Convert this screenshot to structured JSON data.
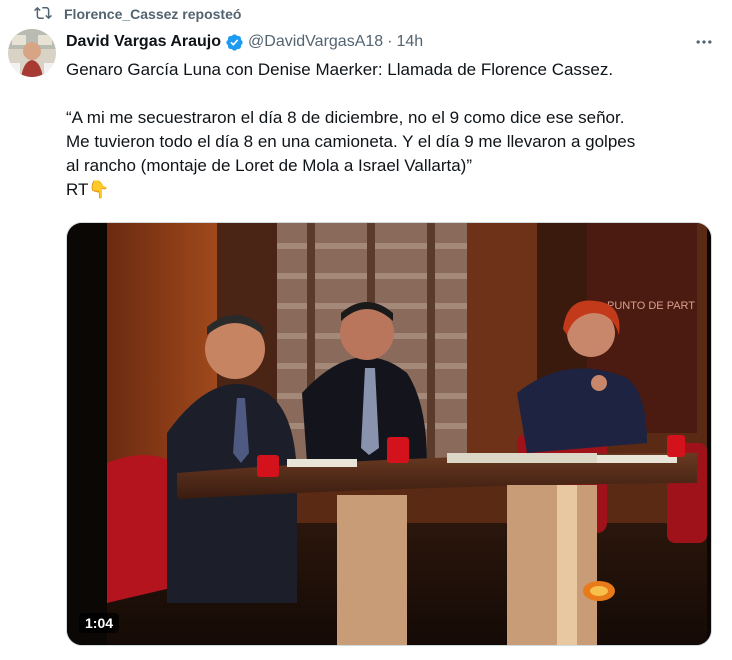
{
  "repost": {
    "label": "Florence_Cassez reposteó"
  },
  "author": {
    "name": "David Vargas Araujo",
    "handle": "@DavidVargasA18",
    "separator": "·",
    "time": "14h"
  },
  "tweet": {
    "line1": "Genaro García Luna con Denise Maerker: Llamada de Florence Cassez.",
    "quote1": "“A mi me secuestraron el día 8 de diciembre, no el 9 como dice ese señor.",
    "quote2": "Me tuvieron todo el día 8 en una camioneta. Y el día 9 me llevaron a golpes",
    "quote3": "al rancho (montaje de Loret de Mola a Israel Vallarta)”",
    "rt": "RT👇"
  },
  "media": {
    "duration": "1:04",
    "backdrop_text": "PUNTO DE PART"
  },
  "icons": {
    "repost": "repost-icon",
    "verified": "verified-badge-icon",
    "more": "more-options-icon"
  },
  "colors": {
    "verified": "#1d9bf0",
    "secondary_text": "#536471"
  }
}
